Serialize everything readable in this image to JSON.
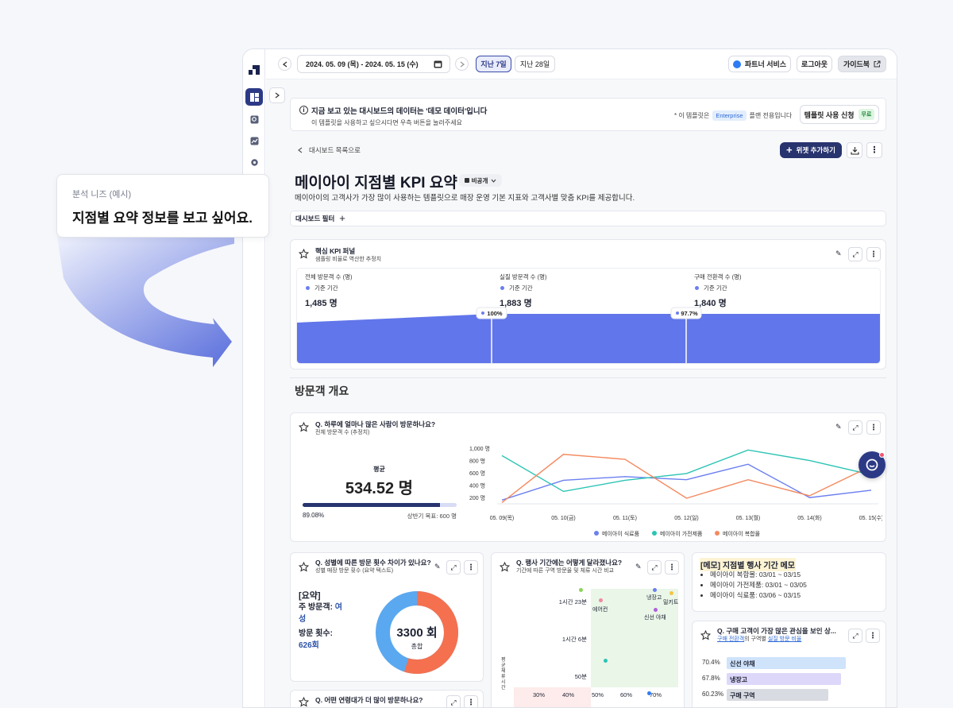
{
  "callout": {
    "label": "분석 니즈 (예시)",
    "text": "지점별 요약 정보를 보고 싶어요."
  },
  "topbar": {
    "date_range": "2024. 05. 09 (목) - 2024. 05. 15 (수)",
    "last7": "지난 7일",
    "last28": "지난 28일",
    "partner": "파트너 서비스",
    "logout": "로그아웃",
    "guide": "가이드북"
  },
  "notice": {
    "title": "지금 보고 있는 대시보드의 데이터는 '데모 데이터'입니다",
    "sub": "이 템플릿을 사용하고 싶으시다면 우측 버튼을 눌러주세요",
    "plan_prefix": "* 이 템플릿은",
    "plan_badge": "Enterprise",
    "plan_suffix": "플랜 전용입니다",
    "apply": "템플릿 사용 신청",
    "free": "무료"
  },
  "header": {
    "back": "대시보드 목록으로",
    "add_widget": "위젯 추가하기",
    "title": "메이아이 지점별 KPI 요약",
    "visibility": "비공개",
    "desc": "메이아이의 고객사가 가장 많이 사용하는 템플릿으로 매장 운영 기본 지표와 고객사별 맞춤 KPI를 제공합니다.",
    "filter": "대시보드 필터"
  },
  "funnel": {
    "title": "핵심 KPI 퍼널",
    "sub": "샘플링 비율로 역산한 추정치",
    "base": "기준 기간",
    "steps": [
      {
        "label": "전체 방문객 수 (명)",
        "value": "1,485 명"
      },
      {
        "label": "실질 방문객 수 (명)",
        "value": "1,883 명"
      },
      {
        "label": "구매 전환객 수 (명)",
        "value": "1,840 명"
      }
    ],
    "rates": [
      "100%",
      "97.7%"
    ]
  },
  "section_title": "방문객 개요",
  "visitors": {
    "title": "Q. 하루에 얼마나 많은 사람이 방문하나요?",
    "sub": "전체 방문객 수 (추정치)",
    "avg_label": "평균",
    "avg": "534.52 명",
    "progress": 0.8908,
    "pct": "89.08%",
    "goal": "상반기 목표: 600 명"
  },
  "chart_data": {
    "type": "line",
    "categories": [
      "05. 09(목)",
      "05. 10(금)",
      "05. 11(토)",
      "05. 12(일)",
      "05. 13(월)",
      "05. 14(화)",
      "05. 15(수)"
    ],
    "yticks": [
      "1,000 명",
      "800 명",
      "600 명",
      "400 명",
      "200 명"
    ],
    "ylim": [
      100,
      1000
    ],
    "series": [
      {
        "name": "메이아이 식료품",
        "color": "#6b7ff0",
        "values": [
          160,
          480,
          540,
          490,
          740,
          200,
          320
        ]
      },
      {
        "name": "메이아이 가전제품",
        "color": "#2cc4b4",
        "values": [
          880,
          300,
          480,
          590,
          970,
          800,
          570
        ]
      },
      {
        "name": "메이아이 복합몰",
        "color": "#f4895f",
        "values": [
          120,
          900,
          820,
          190,
          490,
          230,
          710
        ]
      }
    ]
  },
  "gender": {
    "title": "Q. 성별에 따른 방문 횟수 차이가 있나요?",
    "sub": "성별 매장 방문 횟수 (요약 텍스트)",
    "summary_title": "[요약]",
    "main_label": "주 방문객: ",
    "main_value": "여성",
    "count_label": "방문 횟수: ",
    "count_value": "626회",
    "donut_value": "3300 회",
    "donut_label": "총합",
    "female_share": 0.55
  },
  "event": {
    "title": "Q. 행사 기간에는 어떻게 달라졌나요?",
    "sub": "기간에 따른 구역 방문율 및 체류 시간 비교",
    "y_labels": [
      "1시간 23분",
      "1시간 6분",
      "50분"
    ],
    "x_labels": [
      "30%",
      "40%",
      "50%",
      "60%",
      "70%"
    ],
    "points": [
      "에어컨",
      "냉장고",
      "밀키트",
      "신선 야채"
    ],
    "axis_side": "평균 체류 시간"
  },
  "memo": {
    "title": "[메모] 지점별 행사 기간 메모",
    "items": [
      "메이아이 복합몰: 03/01 ~ 03/15",
      "메이아이 가전제품: 03/01 ~ 03/05",
      "메이아이 식료품: 03/06 ~ 03/15"
    ]
  },
  "interest": {
    "title": "Q. 구매 고객이 가장 많은 관심을 보인 상...",
    "sub_link1": "구매 전환객",
    "sub_mid": "의 구역별 ",
    "sub_link2": "실질 방문 비율",
    "bars": [
      {
        "pct": "70.4%",
        "label": "신선 야채",
        "value": 70.4,
        "color": "#cfe3fb"
      },
      {
        "pct": "67.8%",
        "label": "냉장고",
        "value": 67.8,
        "color": "#ddd8fa"
      },
      {
        "pct": "60.23%",
        "label": "구매 구역",
        "value": 60.23,
        "color": "#d9dbe2"
      }
    ]
  },
  "next": {
    "title": "Q. 어떤 연령대가 더 많이 방문하나요?"
  }
}
